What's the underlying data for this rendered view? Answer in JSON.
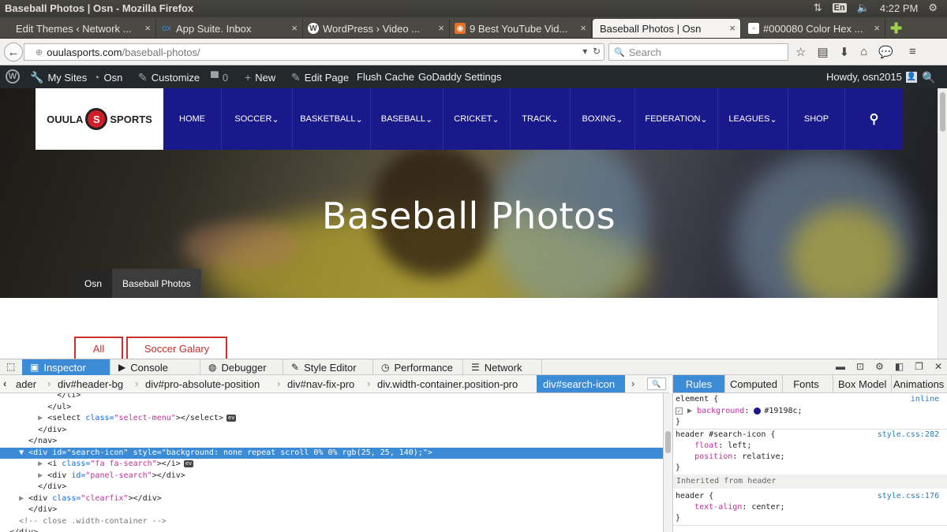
{
  "os_bar": {
    "window_title": "Baseball Photos | Osn - Mozilla Firefox",
    "lang": "En",
    "clock": "4:22 PM"
  },
  "tabs": [
    {
      "label": "Edit Themes ‹ Network ...",
      "icon": "wp-icon"
    },
    {
      "label": "App Suite. Inbox",
      "icon": "mail-icon"
    },
    {
      "label": "WordPress › Video ...",
      "icon": "wordpress-icon"
    },
    {
      "label": "9 Best YouTube Vid...",
      "icon": "orange-site-icon"
    },
    {
      "label": "Baseball Photos | Osn",
      "icon": "",
      "active": true
    },
    {
      "label": "#000080 Color Hex ...",
      "icon": "page-icon"
    }
  ],
  "urlbar": {
    "host": "ouulasports.com",
    "path": "/baseball-photos/",
    "search_placeholder": "Search"
  },
  "wp_admin_bar": {
    "my_sites": "My Sites",
    "site": "Osn",
    "customize": "Customize",
    "comments": "0",
    "new": "New",
    "edit_page": "Edit Page",
    "flush_cache": "Flush Cache",
    "godaddy": "GoDaddy Settings",
    "howdy": "Howdy, osn2015"
  },
  "site": {
    "logo_left": "OUULA",
    "logo_right": "SPORTS",
    "nav": [
      "HOME",
      "SOCCER",
      "BASKETBALL",
      "BASEBALL",
      "CRICKET",
      "TRACK",
      "BOXING",
      "FEDERATION",
      "LEAGUES",
      "SHOP"
    ],
    "nav_dropdown": [
      false,
      true,
      true,
      true,
      true,
      true,
      true,
      true,
      true,
      false
    ],
    "hero_title": "Baseball Photos",
    "breadcrumbs": [
      "Osn",
      "Baseball Photos"
    ],
    "filters": [
      "All",
      "Soccer Galary"
    ],
    "nav_color": "#19198c"
  },
  "devtools": {
    "tabs": [
      "Inspector",
      "Console",
      "Debugger",
      "Style Editor",
      "Performance",
      "Network"
    ],
    "breadcrumbs": [
      "ader",
      "div#header-bg",
      "div#pro-absolute-position",
      "div#nav-fix-pro",
      "div.width-container.position-pro",
      "div#search-icon"
    ],
    "markup": [
      {
        "indent": "            ",
        "tw": "",
        "text": "</li>"
      },
      {
        "indent": "          ",
        "tw": "",
        "text": "</ul>"
      },
      {
        "indent": "        ",
        "tw": "▶ ",
        "pre": "<select ",
        "an": "class=",
        "av": "\"select-menu\"",
        "post": "></select>",
        "ev": true
      },
      {
        "indent": "        ",
        "tw": "",
        "text": "</div>"
      },
      {
        "indent": "      ",
        "tw": "",
        "text": "</nav>"
      },
      {
        "indent": "    ",
        "tw": "▼ ",
        "pre": "<div ",
        "an": "id=",
        "av": "\"search-icon\" style=\"background: none repeat scroll 0% 0% rgb(25, 25, 140);\"",
        "post": ">",
        "selected": true
      },
      {
        "indent": "        ",
        "tw": "▶ ",
        "pre": "<i ",
        "an": "class=",
        "av": "\"fa fa-search\"",
        "post": "></i>",
        "ev": true
      },
      {
        "indent": "        ",
        "tw": "▶ ",
        "pre": "<div ",
        "an": "id=",
        "av": "\"panel-search\"",
        "post": "></div>"
      },
      {
        "indent": "        ",
        "tw": "",
        "text": "</div>"
      },
      {
        "indent": "    ",
        "tw": "▶ ",
        "pre": "<div ",
        "an": "class=",
        "av": "\"clearfix\"",
        "post": "></div>"
      },
      {
        "indent": "      ",
        "tw": "",
        "text": "</div>"
      },
      {
        "indent": "    ",
        "tw": "",
        "comment": "<!-- close .width-container -->"
      },
      {
        "indent": "  ",
        "tw": "",
        "text": "</div>"
      }
    ],
    "side_tabs": [
      "Rules",
      "Computed",
      "Fonts",
      "Box Model",
      "Animations"
    ],
    "rules": {
      "element_selector": "element {",
      "element_source": "inline",
      "bg_prop": "background",
      "bg_value": "#19198c",
      "r2_selector": "header #search-icon {",
      "r2_source": "style.css:282",
      "r2_p1": "float",
      "r2_v1": "left",
      "r2_p2": "position",
      "r2_v2": "relative",
      "inherited_label": "Inherited from header",
      "r3_selector": "header {",
      "r3_source": "style.css:176",
      "r3_p1": "text-align",
      "r3_v1": "center",
      "close": "}"
    }
  }
}
